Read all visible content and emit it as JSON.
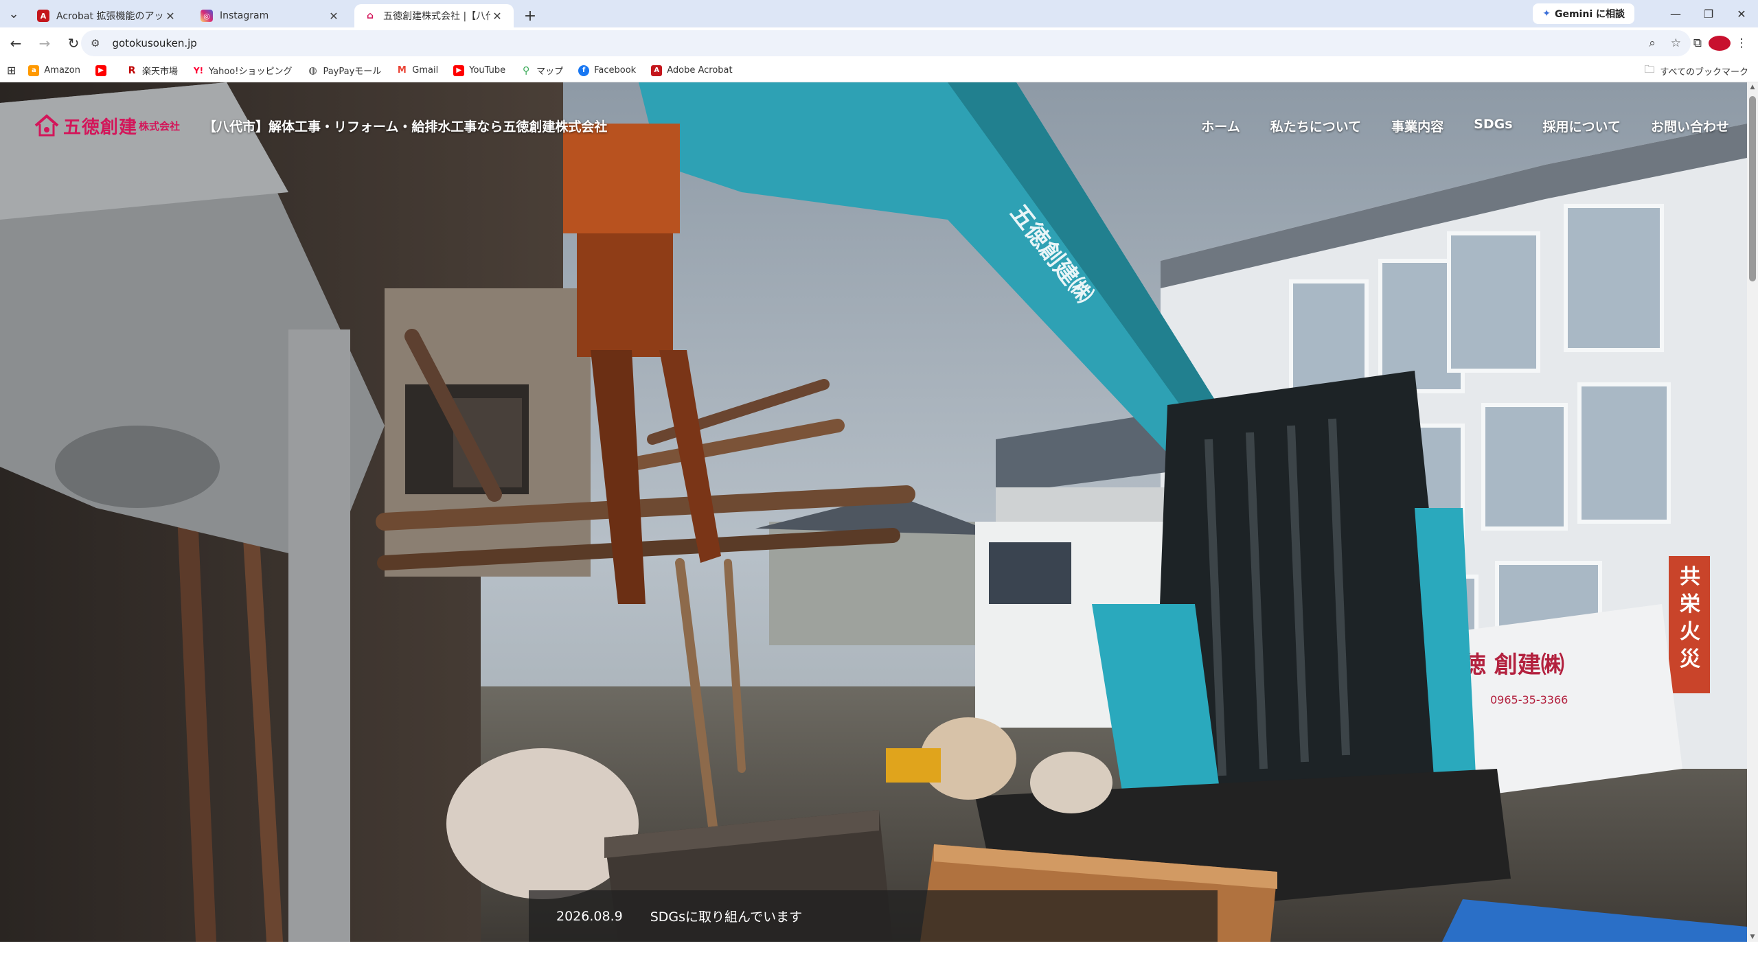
{
  "browser": {
    "tabs": [
      {
        "title": "Acrobat 拡張機能のアップデート",
        "favicon_color": "#c4161c",
        "active": false
      },
      {
        "title": "Instagram",
        "favicon_color": "#d6249f",
        "active": false
      },
      {
        "title": "五徳創建株式会社 |【八代市】解",
        "favicon_color": "#d3165a",
        "active": true
      }
    ],
    "gemini_label": "Gemini に相談",
    "url": "gotokusouken.jp",
    "bookmarks": [
      {
        "label": "Amazon",
        "icon_color": "#ff9900"
      },
      {
        "label": "",
        "icon_color": "#ff0000"
      },
      {
        "label": "楽天市場",
        "icon_color": "#bf0000"
      },
      {
        "label": "Yahoo!ショッピング",
        "icon_color": "#ff0033"
      },
      {
        "label": "PayPayモール",
        "icon_color": "#444444"
      },
      {
        "label": "Gmail",
        "icon_color": "#ea4335"
      },
      {
        "label": "YouTube",
        "icon_color": "#ff0000"
      },
      {
        "label": "マップ",
        "icon_color": "#34a853"
      },
      {
        "label": "Facebook",
        "icon_color": "#1877f2"
      },
      {
        "label": "Adobe Acrobat",
        "icon_color": "#c4161c"
      }
    ],
    "all_bookmarks_label": "すべてのブックマーク"
  },
  "site": {
    "logo_text": "五徳創建",
    "logo_sub": "株式会社",
    "brand_color": "#d3165a",
    "tagline": "【八代市】解体工事・リフォーム・給排水工事なら五徳創建株式会社",
    "nav": [
      "ホーム",
      "私たちについて",
      "事業内容",
      "SDGs",
      "採用について",
      "お問い合わせ"
    ],
    "news": {
      "date": "2026.08.9",
      "title": "SDGsに取り組んでいます"
    },
    "hero": {
      "truck_label": "徳 創建㈱",
      "truck_phone": "0965-35-3366",
      "arm_label": "五徳創建㈱",
      "sign_label": "共栄火災"
    }
  }
}
